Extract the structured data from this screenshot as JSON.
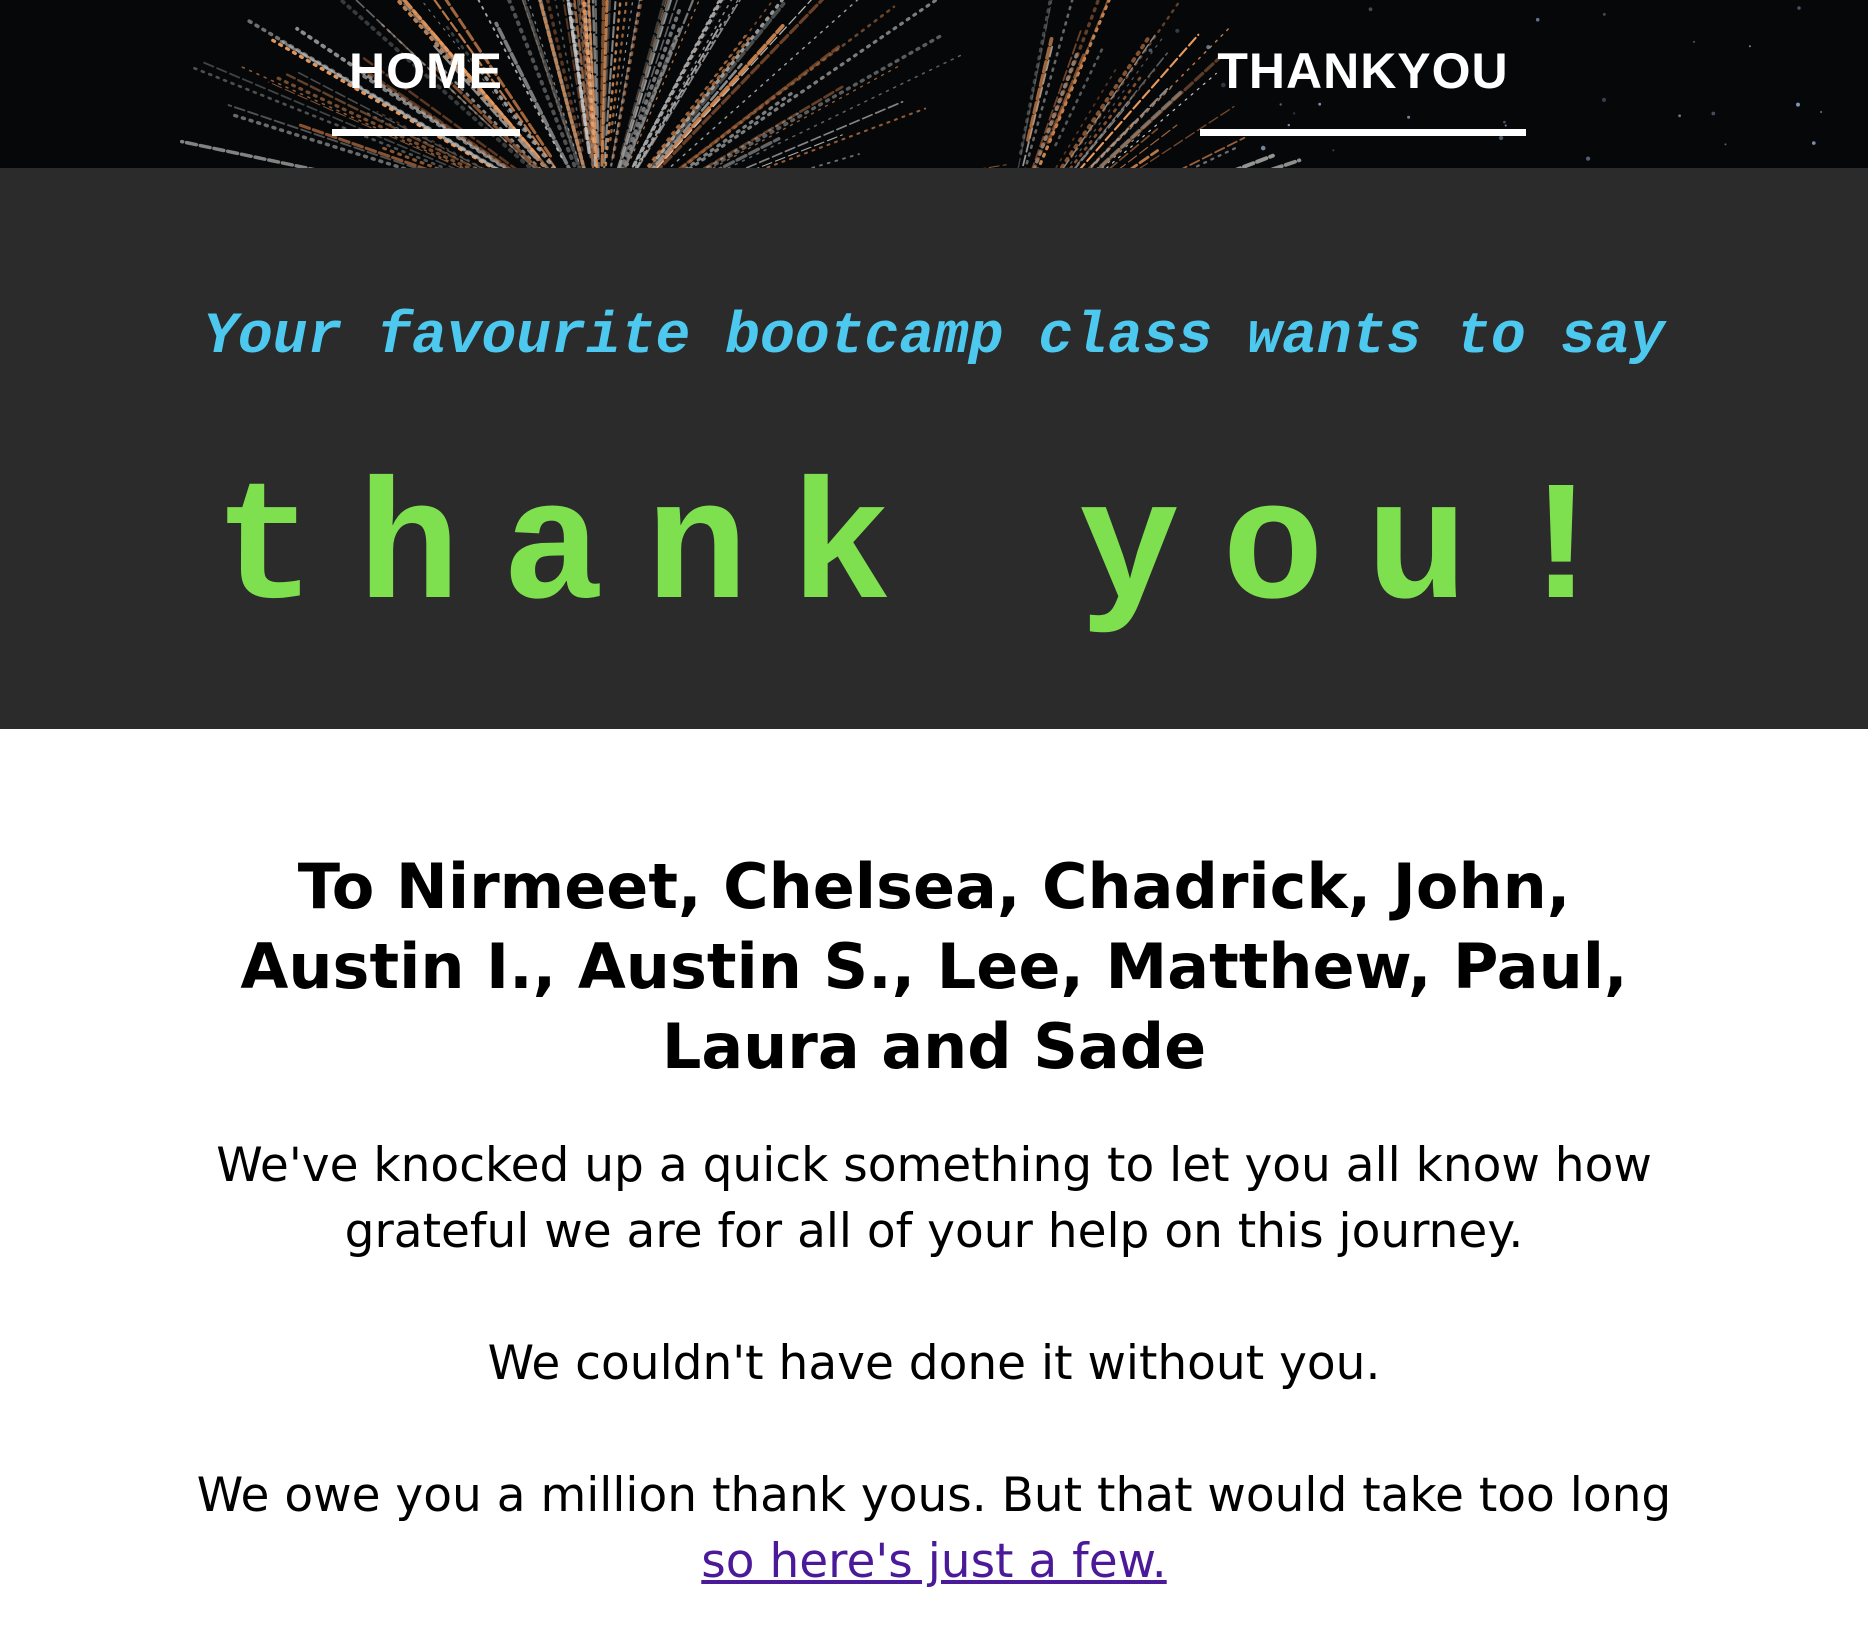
{
  "nav": {
    "home_label": "HOME",
    "thankyou_label": "THANKYOU"
  },
  "hero": {
    "subtitle": "Your favourite bootcamp class wants to say",
    "title": "thank you!"
  },
  "content": {
    "heading": "To Nirmeet, Chelsea, Chadrick, John, Austin I., Austin S., Lee, Matthew, Paul, Laura and Sade",
    "paragraph_1": "We've knocked up a quick something to let you all know how grateful we are for all of your help on this journey.",
    "paragraph_2": "We couldn't have done it without you.",
    "paragraph_3": "We owe you a million thank yous. But that would take too long",
    "link_text": "so here's just a few."
  },
  "colors": {
    "header_bg": "#050708",
    "hero_bg": "#2b2b2b",
    "subtitle": "#4dc9f0",
    "title": "#7ee04e",
    "link": "#4b1a98"
  }
}
